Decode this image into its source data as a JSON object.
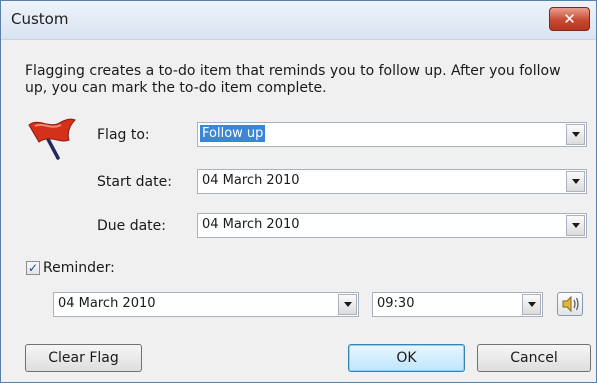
{
  "window": {
    "title": "Custom",
    "close_label": "✕"
  },
  "description": "Flagging creates a to-do item that reminds you to follow up. After you follow up, you can mark the to-do item complete.",
  "fields": {
    "flag_to": {
      "label": "Flag to:",
      "value": "Follow up"
    },
    "start_date": {
      "label": "Start date:",
      "value": "04 March 2010"
    },
    "due_date": {
      "label": "Due date:",
      "value": "04 March 2010"
    }
  },
  "reminder": {
    "label": "Reminder:",
    "checked": true,
    "date": "04 March 2010",
    "time": "09:30"
  },
  "buttons": {
    "clear_flag": "Clear Flag",
    "ok": "OK",
    "cancel": "Cancel"
  },
  "icons": {
    "flag": "red-flag-icon",
    "sound": "speaker-icon",
    "dropdown": "chevron-down-icon"
  },
  "colors": {
    "flag": "#d4301a",
    "selection": "#3b86d6",
    "close_button": "#c74a33"
  }
}
